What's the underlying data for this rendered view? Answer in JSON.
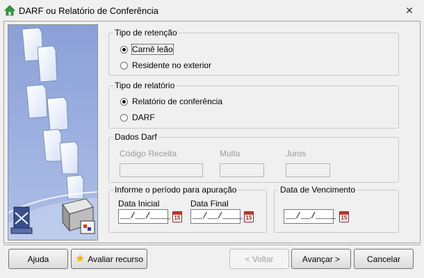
{
  "window": {
    "title": "DARF ou Relatório de Conferência",
    "close_glyph": "✕"
  },
  "tipo_retencao": {
    "legend": "Tipo de retenção",
    "options": [
      {
        "label": "Carnê leão",
        "selected": true
      },
      {
        "label": "Residente no exterior",
        "selected": false
      }
    ]
  },
  "tipo_relatorio": {
    "legend": "Tipo de relatório",
    "options": [
      {
        "label": "Relatório de conferência",
        "selected": true
      },
      {
        "label": "DARF",
        "selected": false
      }
    ]
  },
  "dados_darf": {
    "legend": "Dados Darf",
    "codigo_label": "Código Receita",
    "multa_label": "Multa",
    "juros_label": "Juros"
  },
  "periodo": {
    "legend": "Informe o período para apuração",
    "inicial_label": "Data Inicial",
    "inicial_value": "__/__/____",
    "final_label": "Data Final",
    "final_value": "__/__/____"
  },
  "vencimento": {
    "legend": "Data de Vencimento",
    "value": "__/__/____"
  },
  "calendar_icon_text": "15",
  "buttons": {
    "help": "Ajuda",
    "rate": "Avaliar recurso",
    "back": "< Voltar",
    "next": "Avançar >",
    "cancel": "Cancelar"
  },
  "icons": {
    "app": "house-icon",
    "close": "close-icon",
    "calendar": "calendar-icon",
    "rate": "star-icon"
  }
}
